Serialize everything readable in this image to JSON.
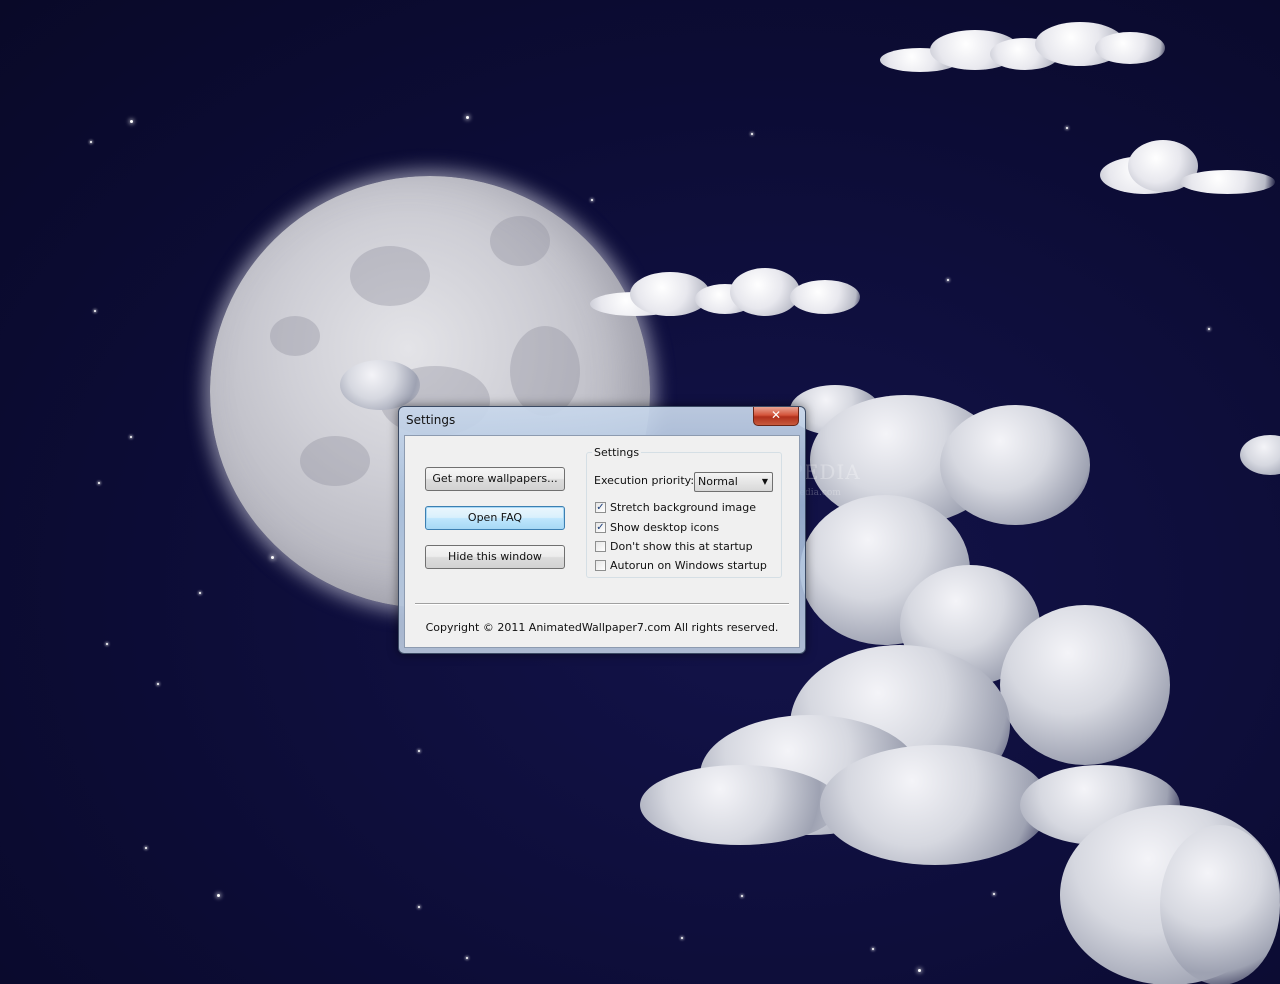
{
  "window": {
    "title": "Settings",
    "close_glyph": "✕",
    "buttons": {
      "get_more": "Get more wallpapers...",
      "open_faq": "Open FAQ",
      "hide": "Hide this window"
    },
    "group": {
      "label": "Settings",
      "priority_label": "Execution priority:",
      "priority_value": "Normal",
      "options": [
        {
          "label": "Stretch background image",
          "checked": true
        },
        {
          "label": "Show desktop icons",
          "checked": true
        },
        {
          "label": "Don't show this at startup",
          "checked": false
        },
        {
          "label": "Autorun on Windows startup",
          "checked": false
        }
      ]
    },
    "copyright": "Copyright © 2011 AnimatedWallpaper7.com All rights reserved."
  },
  "desktop": {
    "watermark": "SOFTPEDIA",
    "watermark_url": "www.softpedia.com"
  },
  "colors": {
    "sky": "#0d0d33",
    "close_button": "#c8432a",
    "focus_button": "#3c7fb1"
  }
}
